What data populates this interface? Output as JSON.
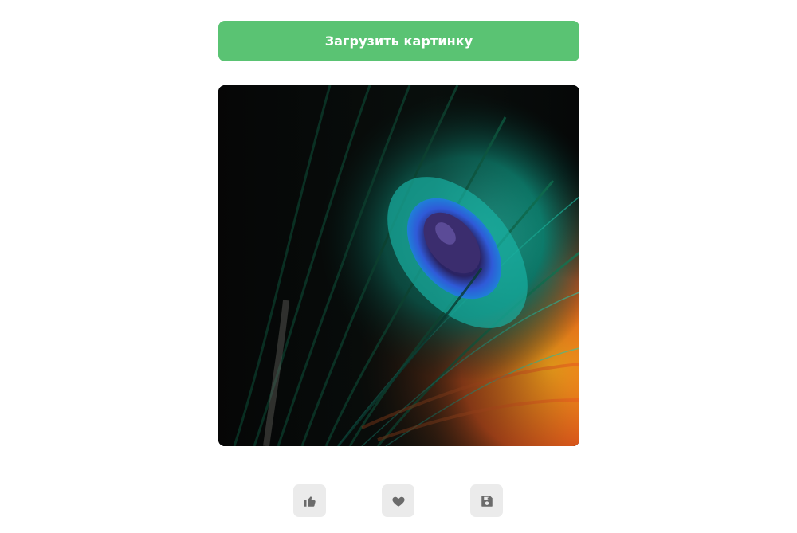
{
  "upload": {
    "label": "Загрузить картинку"
  },
  "image": {
    "subject": "peacock feather close-up"
  },
  "actions": [
    {
      "name": "like",
      "icon": "thumbs-up-icon"
    },
    {
      "name": "favorite",
      "icon": "heart-icon"
    },
    {
      "name": "save",
      "icon": "floppy-disk-icon"
    }
  ],
  "colors": {
    "accent": "#5ac373",
    "button_text": "#ffffff",
    "action_bg": "#ebebeb",
    "icon": "#6b6b6b"
  }
}
